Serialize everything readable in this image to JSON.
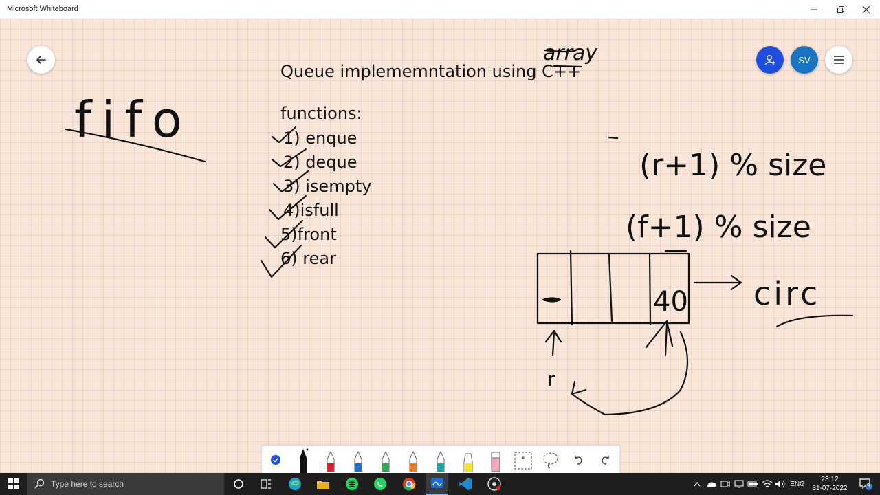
{
  "window": {
    "title": "Microsoft Whiteboard",
    "minimize_icon": "minimize-icon",
    "maximize_icon": "restore-icon",
    "close_icon": "close-icon"
  },
  "board": {
    "back_icon": "back-arrow-icon",
    "share_icon": "add-person-icon",
    "avatar_initials": "SV",
    "menu_icon": "hamburger-menu-icon",
    "heading_array_word": "array",
    "heading_main": "Queue implememntation using C++",
    "fifo_text": "fifo",
    "functions_title": "functions:",
    "functions": [
      "1) enque",
      "2) deque",
      "3) isempty",
      "4)isfull",
      "5)front",
      "6) rear"
    ],
    "formula_rear": "(r+1) % size",
    "formula_front": "(f+1) % size",
    "queue_cell_value": "40",
    "circ_text": "circ",
    "rear_label": "r"
  },
  "toolbar": {
    "tools": [
      "checkmark-icon",
      "black-pen-icon",
      "red-pen-icon",
      "blue-pen-icon",
      "green-pen-icon",
      "orange-pen-icon",
      "teal-pen-icon",
      "highlighter-icon",
      "eraser-icon",
      "ruler-icon",
      "lasso-icon",
      "undo-icon",
      "redo-icon"
    ]
  },
  "taskbar": {
    "search_placeholder": "Type here to search",
    "language": "ENG",
    "time": "23:12",
    "date": "31-07-2022",
    "notification_count": "9"
  }
}
